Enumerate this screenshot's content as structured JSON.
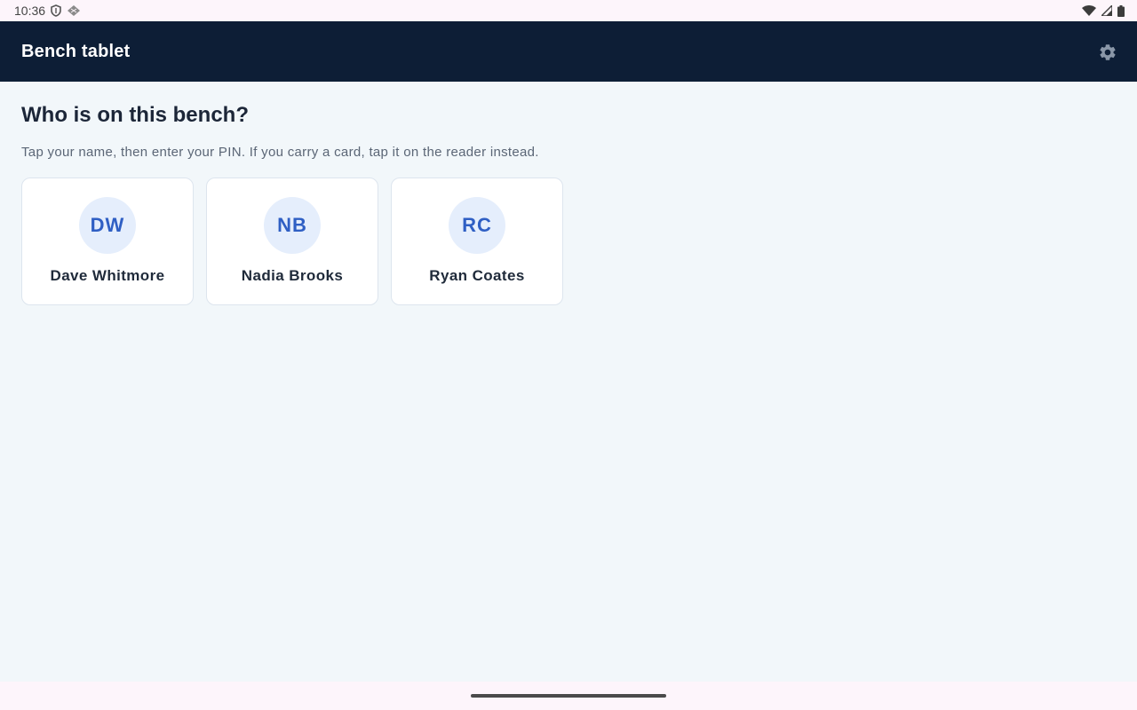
{
  "status_bar": {
    "time": "10:36",
    "left_icons": [
      "shield-icon",
      "diamond-icon"
    ],
    "right_icons": [
      "wifi-icon",
      "signal-icon",
      "battery-icon"
    ]
  },
  "app_bar": {
    "title": "Bench tablet",
    "settings_icon": "gear-icon",
    "background_color": "#0d1e36"
  },
  "main": {
    "heading": "Who is on this bench?",
    "subtext": "Tap your name, then enter your PIN. If you carry a card, tap it on the reader instead.",
    "users": [
      {
        "initials": "DW",
        "name": "Dave Whitmore"
      },
      {
        "initials": "NB",
        "name": "Nadia Brooks"
      },
      {
        "initials": "RC",
        "name": "Ryan Coates"
      }
    ]
  },
  "colors": {
    "accent": "#2f5fc4",
    "avatar_background": "#e5eefc",
    "page_background": "#f2f7fa"
  }
}
